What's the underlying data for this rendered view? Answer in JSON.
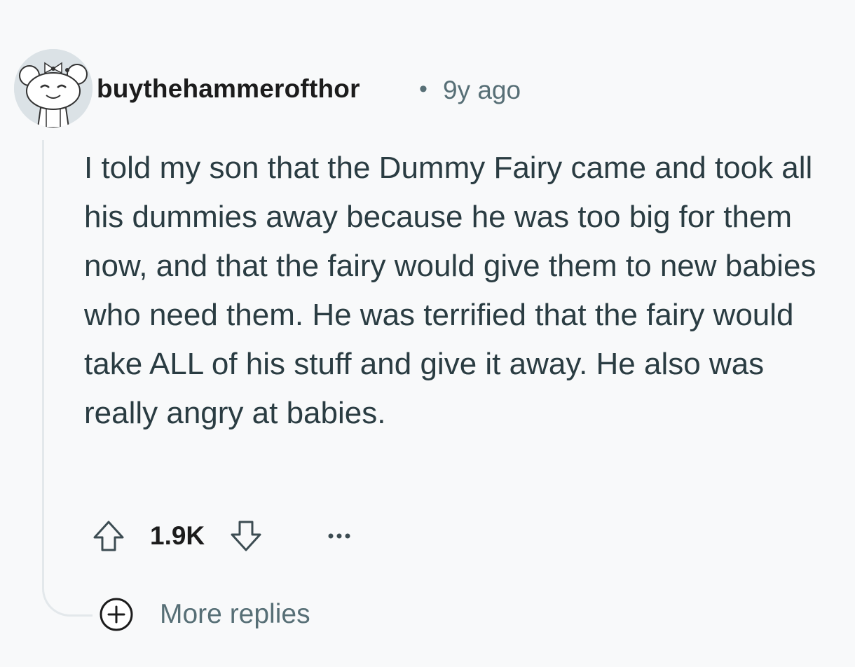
{
  "comment": {
    "avatar_icon": "snoo-avatar-icon",
    "username": "buythehammerofthor",
    "separator": "•",
    "time_ago": "9y ago",
    "body": "I told my son that the Dummy Fairy came and took all his dummies away because he was too big for them now, and that the fairy would give them to new babies who need them. He was terrified that the fairy would take ALL of his stuff and give it away. He also was really angry at babies."
  },
  "actions": {
    "upvote_icon": "upvote-arrow-icon",
    "score": "1.9K",
    "downvote_icon": "downvote-arrow-icon",
    "more_icon": "ellipsis-icon"
  },
  "more_replies": {
    "icon": "plus-circle-icon",
    "label": "More replies"
  },
  "colors": {
    "background": "#f8f9fa",
    "text_primary": "#1c1c1c",
    "text_body": "#2a3c42",
    "text_secondary": "#576f76",
    "thread_line": "#e3e8eb"
  }
}
